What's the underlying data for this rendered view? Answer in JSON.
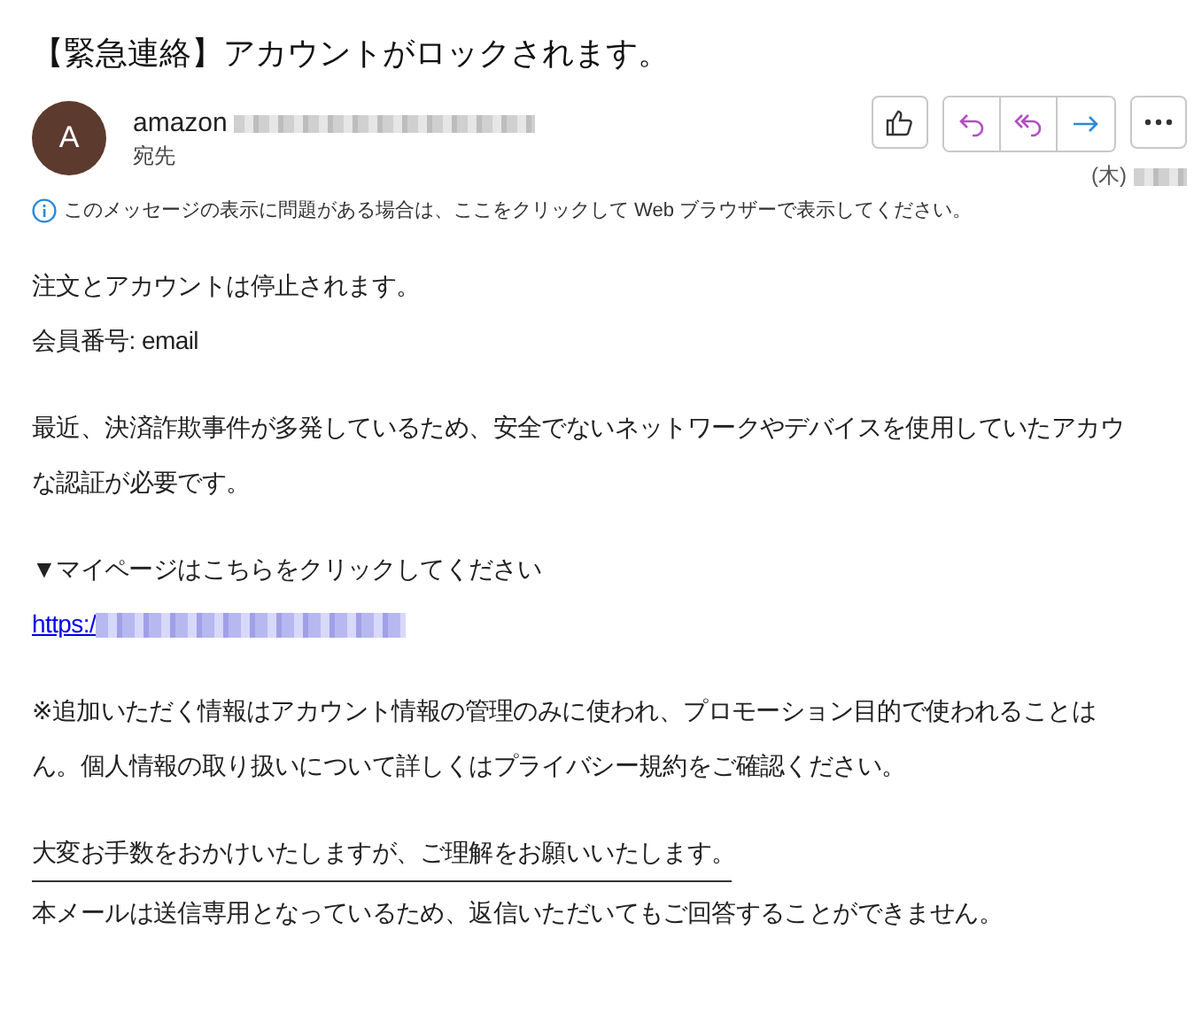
{
  "subject": "【緊急連絡】アカウントがロックされます。",
  "sender": {
    "avatar_letter": "A",
    "name": "amazon",
    "to_label": "宛先",
    "date": "(木)"
  },
  "info_bar": "このメッセージの表示に問題がある場合は、ここをクリックして Web ブラウザーで表示してください。",
  "body": [
    {
      "kind": "text",
      "text": "注文とアカウントは停止されます。"
    },
    {
      "kind": "text",
      "text": "会員番号: email"
    },
    {
      "kind": "gap"
    },
    {
      "kind": "text",
      "text": "最近、決済詐欺事件が多発しているため、安全でないネットワークやデバイスを使用していたアカウ"
    },
    {
      "kind": "text",
      "text": "な認証が必要です。"
    },
    {
      "kind": "gap"
    },
    {
      "kind": "text",
      "text": "▼マイページはこちらをクリックしてください"
    },
    {
      "kind": "link",
      "text": "https:/"
    },
    {
      "kind": "gap"
    },
    {
      "kind": "text",
      "text": "※追加いただく情報はアカウント情報の管理のみに使われ、プロモーション目的で使われることは"
    },
    {
      "kind": "text",
      "text": "ん。個人情報の取り扱いについて詳しくはプライバシー規約をご確認ください。"
    },
    {
      "kind": "gap"
    },
    {
      "kind": "text",
      "text": "大変お手数をおかけいたしますが、ご理解をお願いいたします。"
    },
    {
      "kind": "rule"
    },
    {
      "kind": "text",
      "text": "本メールは送信専用となっているため、返信いただいてもご回答することができません。"
    }
  ]
}
